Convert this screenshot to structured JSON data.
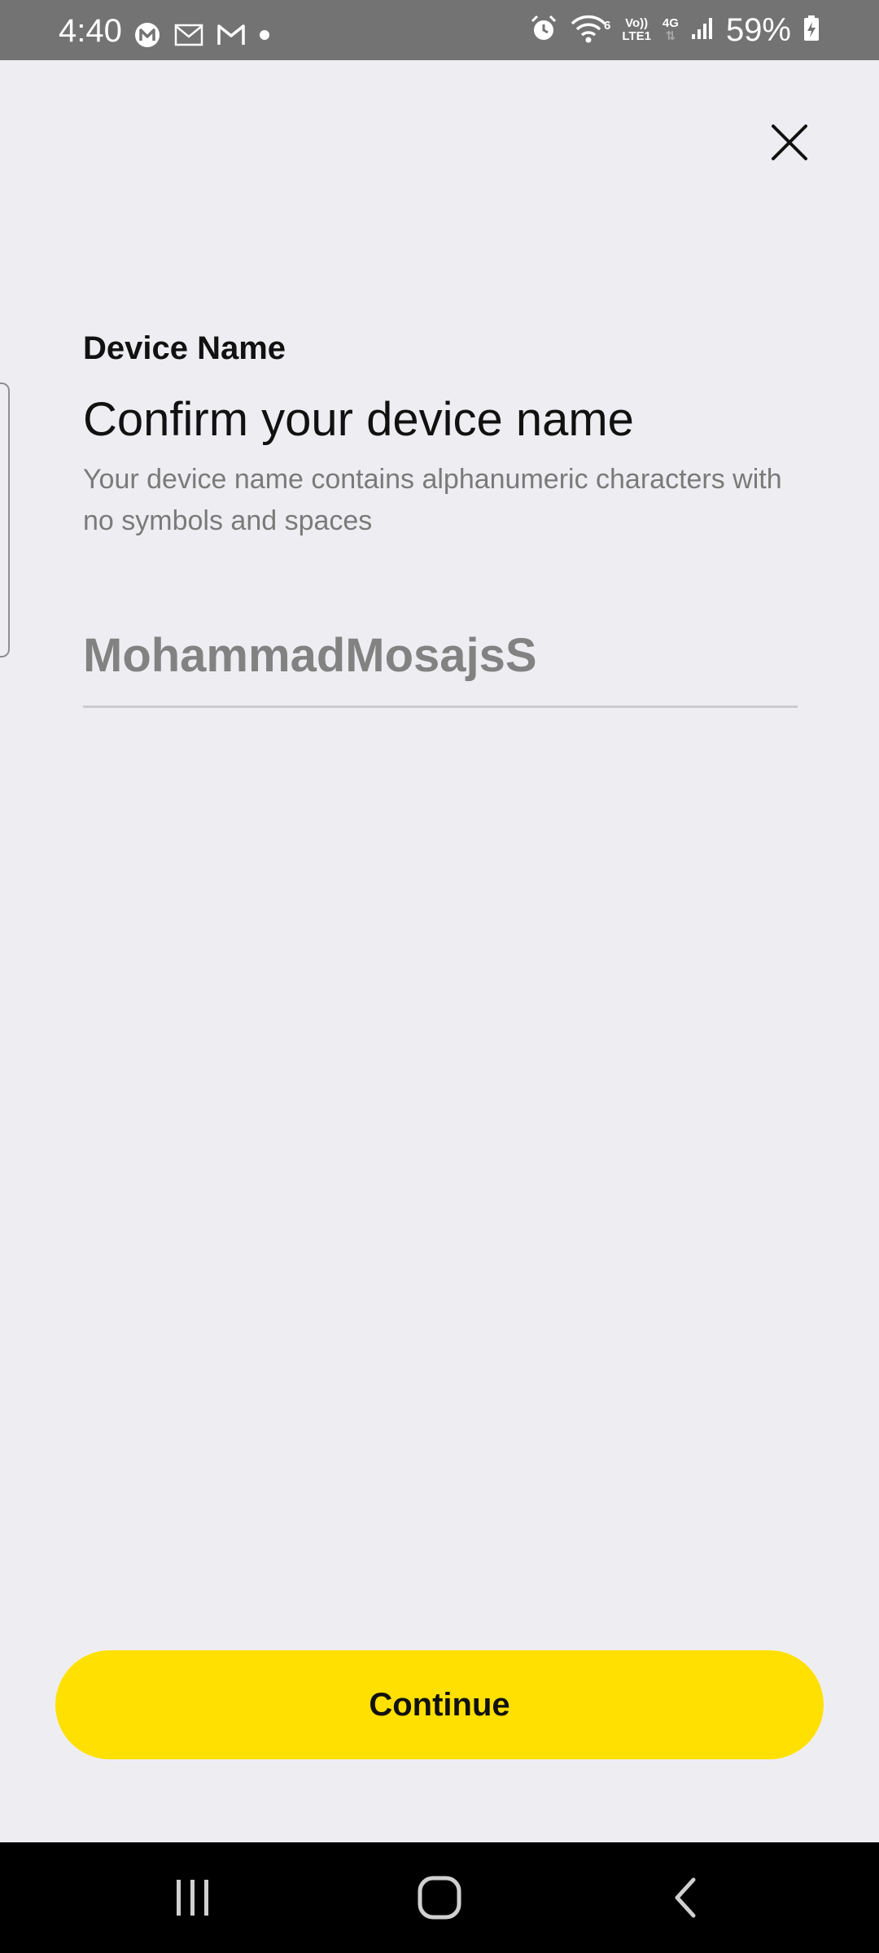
{
  "status_bar": {
    "time": "4:40",
    "battery_percent": "59%",
    "network_type": "4G",
    "volte_label": "Vo))",
    "lte_label": "LTE1",
    "wifi_label": "6",
    "left_icons": [
      "m-app-icon",
      "mail-icon",
      "gmail-icon",
      "dot-icon"
    ],
    "right_icons": [
      "alarm-icon",
      "wifi-icon",
      "signal-icon",
      "battery-charging-icon"
    ],
    "background": "#737373"
  },
  "header": {
    "close_icon": "close-icon"
  },
  "content": {
    "section_label": "Device Name",
    "title": "Confirm your device name",
    "description": "Your device name contains alphanumeric characters with no symbols and spaces",
    "device_name_value": "MohammadMosajsS"
  },
  "footer": {
    "continue_label": "Continue",
    "continue_color": "#FFE000"
  },
  "nav_bar": {
    "buttons": [
      "recent-apps-icon",
      "home-icon",
      "back-icon"
    ]
  },
  "colors": {
    "background": "#EEEEF2",
    "text_primary": "#111111",
    "text_secondary": "#7A7A7A"
  }
}
